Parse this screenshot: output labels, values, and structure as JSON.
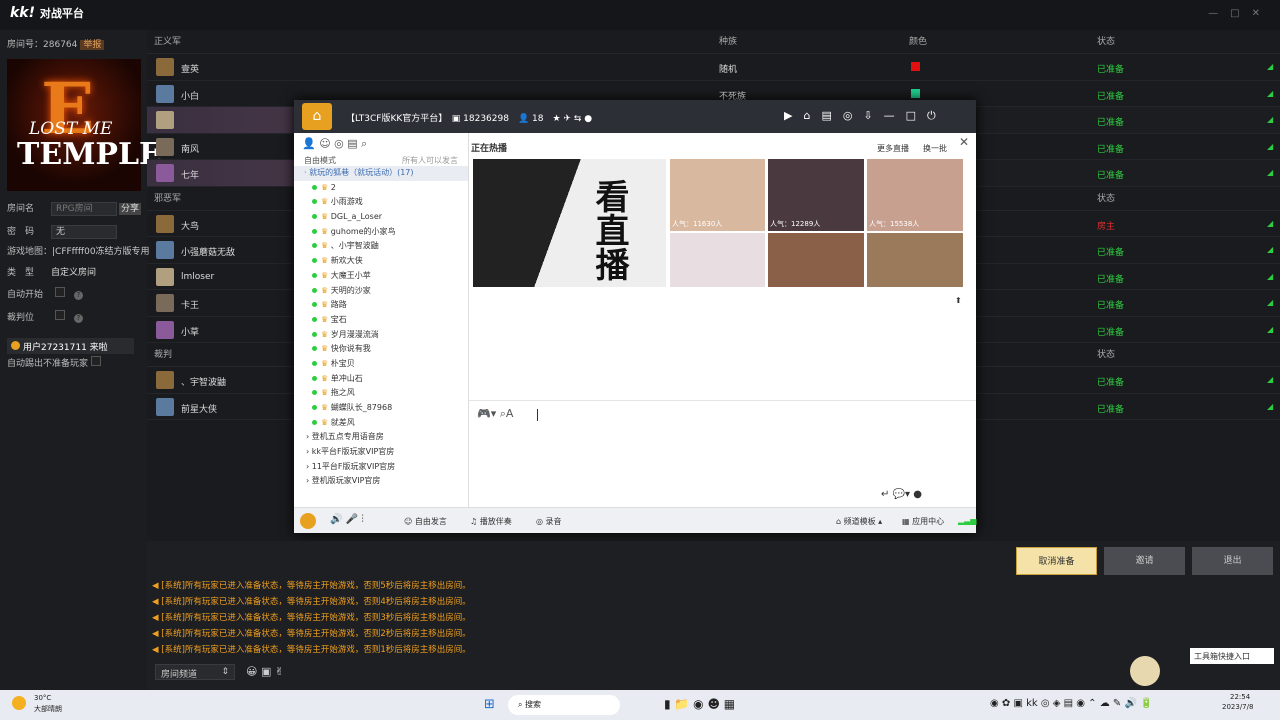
{
  "app": {
    "logo": "kk!",
    "title": "对战平台"
  },
  "room": {
    "label": "房间号：",
    "number": "286764",
    "tag": "举报"
  },
  "poster": {
    "line1": "E",
    "line2": "LOST ME",
    "line3": "TEMPLE"
  },
  "form": {
    "room_name_label": "房间名",
    "room_name_placeholder": "RPG房间",
    "share": "分享",
    "password_label": "密　码",
    "password_value": "无",
    "map_label": "游戏地图：",
    "map_value": "|CFFffff00冻结方版专用",
    "type_label": "类　型",
    "type_value": "自定义房间",
    "autostart_label": "自动开始",
    "referee_label": "裁判位",
    "kick_label": "自动踢出不准备玩家",
    "user_chip": "用户27231711 来啦"
  },
  "table": {
    "justice_header": "正义军",
    "race_header": "种族",
    "color_header": "颜色",
    "status_header": "状态",
    "evil_header": "邪恶军",
    "evil_status": "状态",
    "judge_header": "裁判",
    "judge_status": "状态",
    "justice": [
      {
        "name": "壹英",
        "race": "随机",
        "color": "#e01010",
        "status": "已准备"
      },
      {
        "name": "小白",
        "race": "不死族",
        "color": "#20d090",
        "status": "已准备"
      },
      {
        "name": "",
        "race": "",
        "color": "",
        "status": "已准备"
      },
      {
        "name": "南风",
        "race": "",
        "color": "",
        "status": "已准备"
      },
      {
        "name": "七年",
        "race": "",
        "color": "",
        "status": "已准备"
      }
    ],
    "evil": [
      {
        "name": "大鸟",
        "status": "房主"
      },
      {
        "name": "小强蘑菇无敌",
        "status": "已准备"
      },
      {
        "name": "lmloser",
        "status": "已准备"
      },
      {
        "name": "卡王",
        "status": "已准备"
      },
      {
        "name": "小草",
        "status": "已准备"
      }
    ],
    "judge": [
      {
        "name": "、宇智波鼬",
        "status": "已准备"
      },
      {
        "name": "前星大侠",
        "status": "已准备"
      }
    ]
  },
  "kk": {
    "title": "【LT3CF版KK官方平台】",
    "channel_id": "18236298",
    "online": "18",
    "tree_top1": "自由模式",
    "tree_top2": "所有人可以发言",
    "tree_group": "· 就玩的狐巷（就玩话动）(17)",
    "members": [
      "2",
      "小雨游戏",
      "DGL_a_Loser",
      "guhome的小家鸟",
      "、小宇智波鼬",
      "新欢大侠",
      "大魔王小苹",
      "天明的沙家",
      "路路",
      "宝石",
      "岁月漫漫流淌",
      "快你说有我",
      "朴宝贝",
      "单冲山石",
      "拖之风",
      "蝴蝶队长_87968",
      "就差风"
    ],
    "tree_more": [
      "登机五点专用语音房",
      "kk平台F版玩家VIP官房",
      "11平台F版玩家VIP官房",
      "登机版玩家VIP官房"
    ],
    "live_label": "正在热播",
    "more": "更多直播",
    "change": "换一批",
    "hero_text": "看直播",
    "viewers": [
      "人气：11630人",
      "人气：12289人",
      "人气：15538人"
    ],
    "bar": {
      "free_speak": "自由发言",
      "music": "播放伴奏",
      "record": "录音",
      "channel_mode": "频道模板",
      "app_center": "应用中心"
    }
  },
  "buttons": {
    "cancel": "取消准备",
    "invite": "邀请",
    "exit": "退出"
  },
  "messages": [
    "[系统]所有玩家已进入准备状态，等待房主开始游戏，否则5秒后将房主移出房间。",
    "[系统]所有玩家已进入准备状态，等待房主开始游戏，否则4秒后将房主移出房间。",
    "[系统]所有玩家已进入准备状态，等待房主开始游戏，否则3秒后将房主移出房间。",
    "[系统]所有玩家已进入准备状态，等待房主开始游戏，否则2秒后将房主移出房间。",
    "[系统]所有玩家已进入准备状态，等待房主开始游戏，否则1秒后将房主移出房间。"
  ],
  "chat_channel": "房间频道",
  "tooltip": "工具箱快捷入口",
  "taskbar": {
    "temp": "30°C",
    "weather": "大部晴朗",
    "search": "搜索",
    "time": "22:54",
    "date": "2023/7/8"
  }
}
